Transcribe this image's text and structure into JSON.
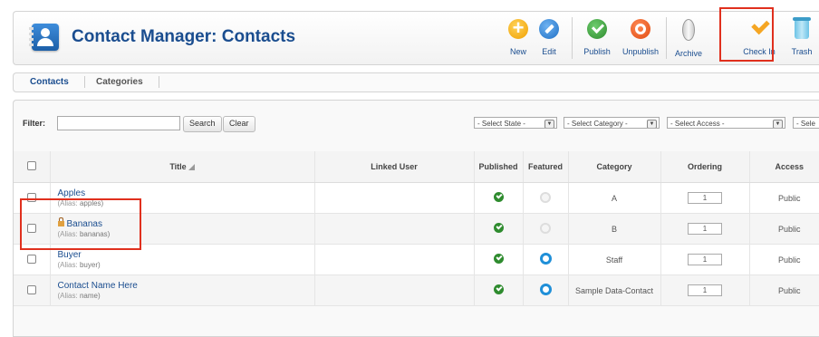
{
  "header": {
    "title": "Contact Manager: Contacts",
    "logo_icon": "contacts-book-icon",
    "toolbar": [
      {
        "label": "New",
        "icon": "plus-circle-icon"
      },
      {
        "label": "Edit",
        "icon": "pencil-circle-icon"
      },
      {
        "label": "Publish",
        "icon": "check-circle-icon"
      },
      {
        "label": "Unpublish",
        "icon": "unpublish-circle-icon"
      },
      {
        "label": "Archive",
        "icon": "archive-icon"
      },
      {
        "label": "Check In",
        "icon": "checkmark-icon"
      },
      {
        "label": "Trash",
        "icon": "trash-icon"
      }
    ],
    "highlight_color": "#e0301e"
  },
  "tabs": [
    {
      "label": "Contacts",
      "active": true
    },
    {
      "label": "Categories",
      "active": false
    }
  ],
  "filters": {
    "label": "Filter:",
    "input_value": "",
    "search_label": "Search",
    "clear_label": "Clear",
    "selects": [
      "- Select State -",
      "- Select Category -",
      "- Select Access -",
      "- Sele"
    ]
  },
  "table": {
    "columns": [
      "",
      "Title",
      "Linked User",
      "Published",
      "Featured",
      "Category",
      "Ordering",
      "Access"
    ],
    "rows": [
      {
        "name": "Apples",
        "alias_label": "(Alias:",
        "alias": "apples)",
        "linked_user": "",
        "published": true,
        "featured": false,
        "category": "A",
        "ordering": "1",
        "access": "Public",
        "checked_out": false
      },
      {
        "name": "Bananas",
        "alias_label": "(Alias:",
        "alias": "bananas)",
        "linked_user": "",
        "published": true,
        "featured": false,
        "category": "B",
        "ordering": "1",
        "access": "Public",
        "checked_out": true
      },
      {
        "name": "Buyer",
        "alias_label": "(Alias:",
        "alias": "buyer)",
        "linked_user": "",
        "published": true,
        "featured": true,
        "category": "Staff",
        "ordering": "1",
        "access": "Public",
        "checked_out": false
      },
      {
        "name": "Contact Name Here",
        "alias_label": "(Alias:",
        "alias": "name)",
        "linked_user": "",
        "published": true,
        "featured": true,
        "category": "Sample Data-Contact",
        "ordering": "1",
        "access": "Public",
        "checked_out": false
      }
    ]
  },
  "colors": {
    "title_blue": "#1a4d8f",
    "published_green": "#2e8b2e",
    "featured_blue": "#1f8fd8",
    "checkin_orange": "#f5a623"
  }
}
